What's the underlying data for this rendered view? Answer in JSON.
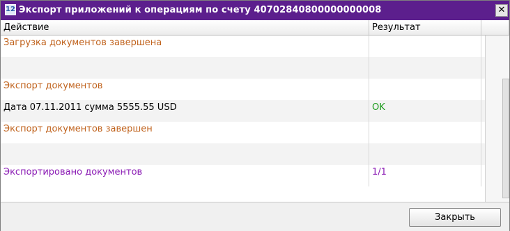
{
  "window": {
    "title": "Экспорт приложений к операциям по счету 40702840800000000008",
    "app_icon_glyph": "12",
    "close_glyph": "✕"
  },
  "columns": [
    "Действие",
    "Результат"
  ],
  "rows": [
    {
      "action": "Загрузка документов завершена",
      "result": "",
      "color": "#c0621c"
    },
    {
      "action": "",
      "result": "",
      "color": "#000000"
    },
    {
      "action": "Экспорт документов",
      "result": "",
      "color": "#c0621c"
    },
    {
      "action": "Дата 07.11.2011 сумма 5555.55 USD",
      "result": "OK",
      "color": "#000000",
      "result_color": "#1a9a1a"
    },
    {
      "action": "Экспорт документов завершен",
      "result": "",
      "color": "#c0621c"
    },
    {
      "action": "",
      "result": "",
      "color": "#000000"
    },
    {
      "action": "Экспортировано документов",
      "result": "1/1",
      "color": "#8a1ab4"
    }
  ],
  "footer": {
    "close_button": "Закрыть"
  },
  "icons": {
    "app": "app-icon",
    "close": "close-icon"
  }
}
